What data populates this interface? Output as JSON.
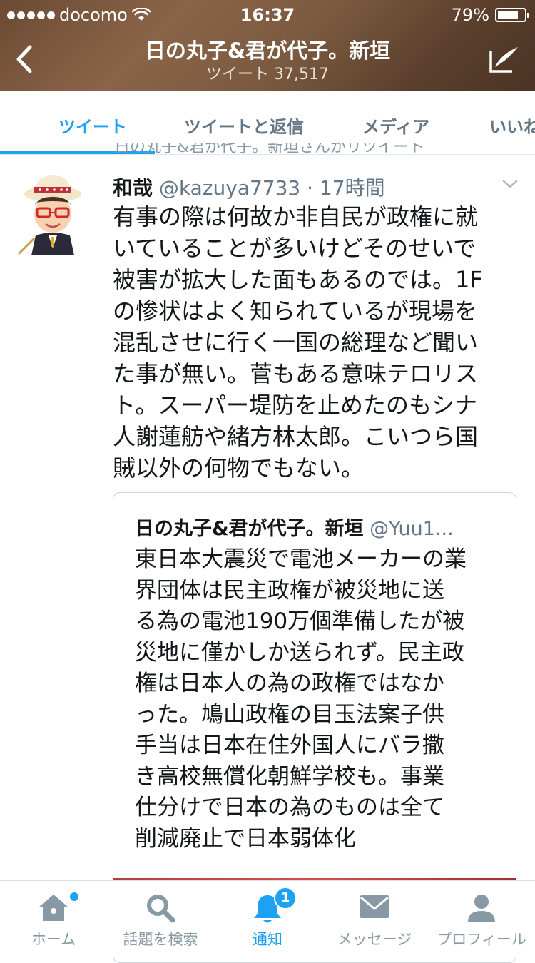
{
  "status_bar": {
    "carrier": "docomo",
    "time": "16:37",
    "battery": "79%",
    "battery_level": 0.79
  },
  "header": {
    "title": "日の丸子&君が代子。新垣",
    "subtitle": "ツイート 37,517"
  },
  "tabs": [
    {
      "label": "ツイート",
      "active": true
    },
    {
      "label": "ツイートと返信",
      "active": false
    },
    {
      "label": "メディア",
      "active": false
    },
    {
      "label": "いいね",
      "active": false
    }
  ],
  "retweet_note": "日の丸子&君が代子。新垣さんがリツイート",
  "tweet": {
    "name": "和哉",
    "handle": "@kazuya7733",
    "time": "17時間",
    "lines": [
      "有事の際は何故か非自民が政権に就",
      "いていることが多いけどそのせいで",
      "被害が拡大した面もあるのでは。1F",
      "の惨状はよく知られているが現場を",
      "混乱させに行く一国の総理など聞い",
      "た事が無い。菅もある意味テロリス",
      "ト。スーパー堤防を止めたのもシナ",
      "人謝蓮舫や緒方林太郎。こいつら国",
      "賊以外の何物でもない。"
    ]
  },
  "quoted": {
    "name": "日の丸子&君が代子。新垣",
    "handle": "@Yuu1...",
    "lines": [
      "東日本大震災で電池メーカーの業",
      "界団体は民主政権が被災地に送",
      "る為の電池190万個準備したが被",
      "災地に僅かしか送られず。民主政",
      "権は日本人の為の政権ではなか",
      "った。鳩山政権の目玉法案子供",
      "手当は日本在住外国人にバラ撒",
      "き高校無償化朝鮮学校も。事業",
      "仕分けで日本の為のものは全て",
      "削減廃止で日本弱体化"
    ]
  },
  "bottom_nav": [
    {
      "label": "ホーム",
      "icon": "home-icon",
      "active": false
    },
    {
      "label": "話題を検索",
      "icon": "search-icon",
      "active": false
    },
    {
      "label": "通知",
      "icon": "bell-icon",
      "active": true,
      "badge": "1"
    },
    {
      "label": "メッセージ",
      "icon": "envelope-icon",
      "active": false
    },
    {
      "label": "プロフィール",
      "icon": "profile-icon",
      "active": false
    }
  ],
  "colors": {
    "accent": "#1da1f2",
    "text": "#14171a",
    "muted": "#657786"
  }
}
